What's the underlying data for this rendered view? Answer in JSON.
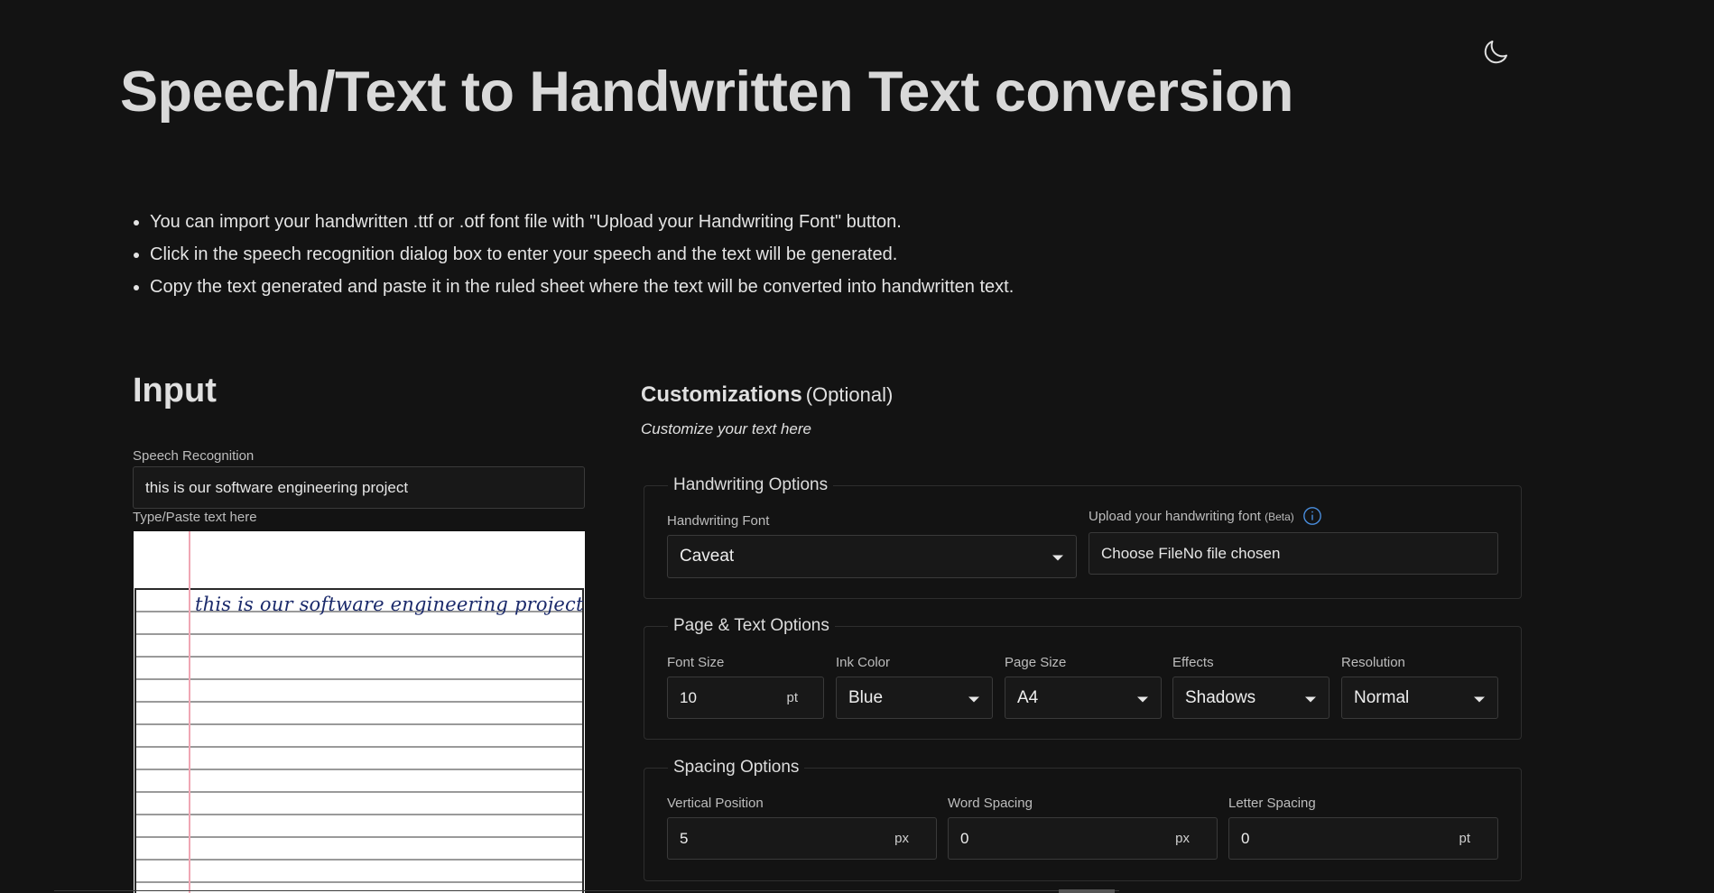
{
  "header": {
    "title": "Speech/Text to Handwritten Text conversion",
    "theme_icon": "moon-icon"
  },
  "instructions": [
    "You can import your handwritten .ttf or .otf font file with \"Upload your Handwriting Font\" button.",
    "Click in the speech recognition dialog box to enter your speech and the text will be generated.",
    "Copy the text generated and paste it in the ruled sheet where the text will be converted into handwritten text."
  ],
  "input": {
    "heading": "Input",
    "speech_label": "Speech Recognition",
    "speech_value": "this is our software engineering project",
    "paste_label": "Type/Paste text here",
    "sheet_text": "this is our software engineering project"
  },
  "customizations": {
    "heading": "Customizations",
    "optional": "(Optional)",
    "subtitle": "Customize your text here",
    "handwriting": {
      "legend": "Handwriting Options",
      "font_label": "Handwriting Font",
      "font_value": "Caveat",
      "upload_label": "Upload your handwriting font",
      "upload_beta": "(Beta)",
      "upload_value": "Choose FileNo file chosen",
      "info_icon": "info-icon"
    },
    "page_text": {
      "legend": "Page & Text Options",
      "font_size_label": "Font Size",
      "font_size_value": "10",
      "font_size_unit": "pt",
      "ink_color_label": "Ink Color",
      "ink_color_value": "Blue",
      "page_size_label": "Page Size",
      "page_size_value": "A4",
      "effects_label": "Effects",
      "effects_value": "Shadows",
      "resolution_label": "Resolution",
      "resolution_value": "Normal"
    },
    "spacing": {
      "legend": "Spacing Options",
      "vertical_label": "Vertical Position",
      "vertical_value": "5",
      "vertical_unit": "px",
      "word_label": "Word Spacing",
      "word_value": "0",
      "word_unit": "px",
      "letter_label": "Letter Spacing",
      "letter_value": "0",
      "letter_unit": "pt"
    }
  },
  "colors": {
    "background": "#131313",
    "ink": "#1b2a6b",
    "info_accent": "#4a8fe0",
    "margin_line": "#f0a7b4"
  }
}
